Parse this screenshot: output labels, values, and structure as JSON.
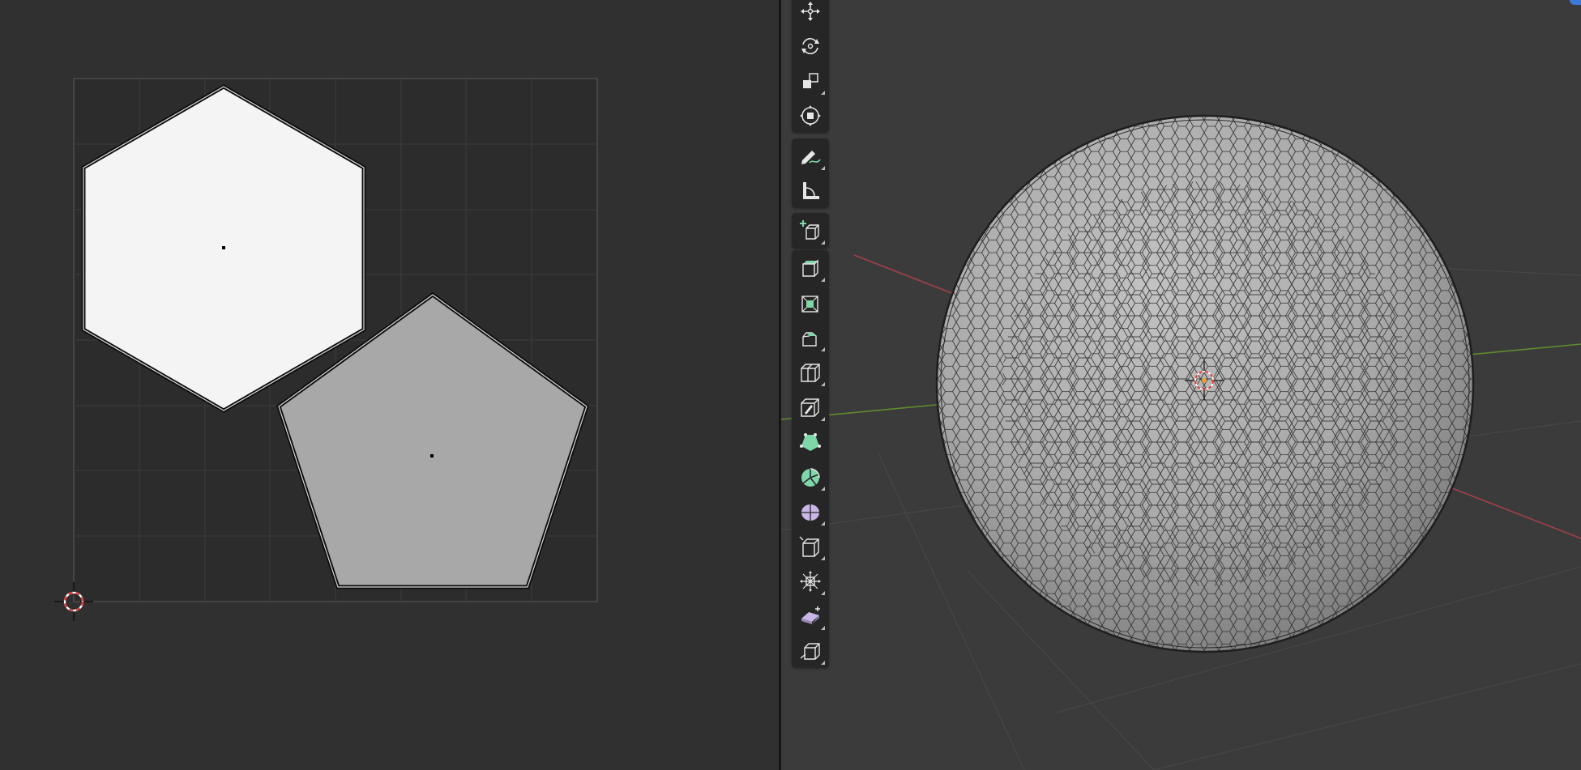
{
  "colors": {
    "uv_background": "#303030",
    "viewport_background": "#3b3b3b",
    "toolbar_background": "#262626",
    "hexagon_face": "#f4f4f4",
    "pentagon_face": "#a8a8a8",
    "sphere_face": "#b0b0b0",
    "x_axis": "#a4404a",
    "y_axis": "#5f8c2f",
    "tool_accent_green": "#7fd6a8",
    "tool_accent_purple": "#c9b6e6",
    "selection_blue": "#3d7ad6"
  },
  "uv_editor": {
    "grid_divisions": 8,
    "islands": [
      {
        "name": "hexagon",
        "sides": 6,
        "selected": true
      },
      {
        "name": "pentagon",
        "sides": 5,
        "selected": false
      }
    ],
    "cursor_icon": "2d-cursor-icon"
  },
  "viewport": {
    "object": "hexagon-tiled-sphere",
    "gizmo_icon": "3d-cursor-icon"
  },
  "toolbar": {
    "tools": [
      {
        "name": "move",
        "icon": "move-icon"
      },
      {
        "name": "rotate",
        "icon": "rotate-icon"
      },
      {
        "name": "scale",
        "icon": "scale-icon"
      },
      {
        "name": "transform",
        "icon": "transform-icon"
      },
      {
        "name": "annotate",
        "icon": "annotate-pencil-icon"
      },
      {
        "name": "measure",
        "icon": "measure-ruler-icon"
      },
      {
        "name": "add-cube",
        "icon": "add-cube-icon"
      },
      {
        "name": "extrude-region",
        "icon": "extrude-region-icon"
      },
      {
        "name": "inset-faces",
        "icon": "inset-faces-icon"
      },
      {
        "name": "bevel",
        "icon": "bevel-icon"
      },
      {
        "name": "loop-cut",
        "icon": "loop-cut-icon"
      },
      {
        "name": "knife",
        "icon": "knife-icon"
      },
      {
        "name": "poly-build",
        "icon": "poly-build-icon"
      },
      {
        "name": "spin",
        "icon": "spin-icon"
      },
      {
        "name": "smooth",
        "icon": "smooth-vertices-icon"
      },
      {
        "name": "edge-slide",
        "icon": "edge-slide-icon"
      },
      {
        "name": "shrink-fatten",
        "icon": "shrink-fatten-icon"
      },
      {
        "name": "shear",
        "icon": "shear-icon"
      },
      {
        "name": "rip-region",
        "icon": "rip-region-icon"
      }
    ]
  }
}
